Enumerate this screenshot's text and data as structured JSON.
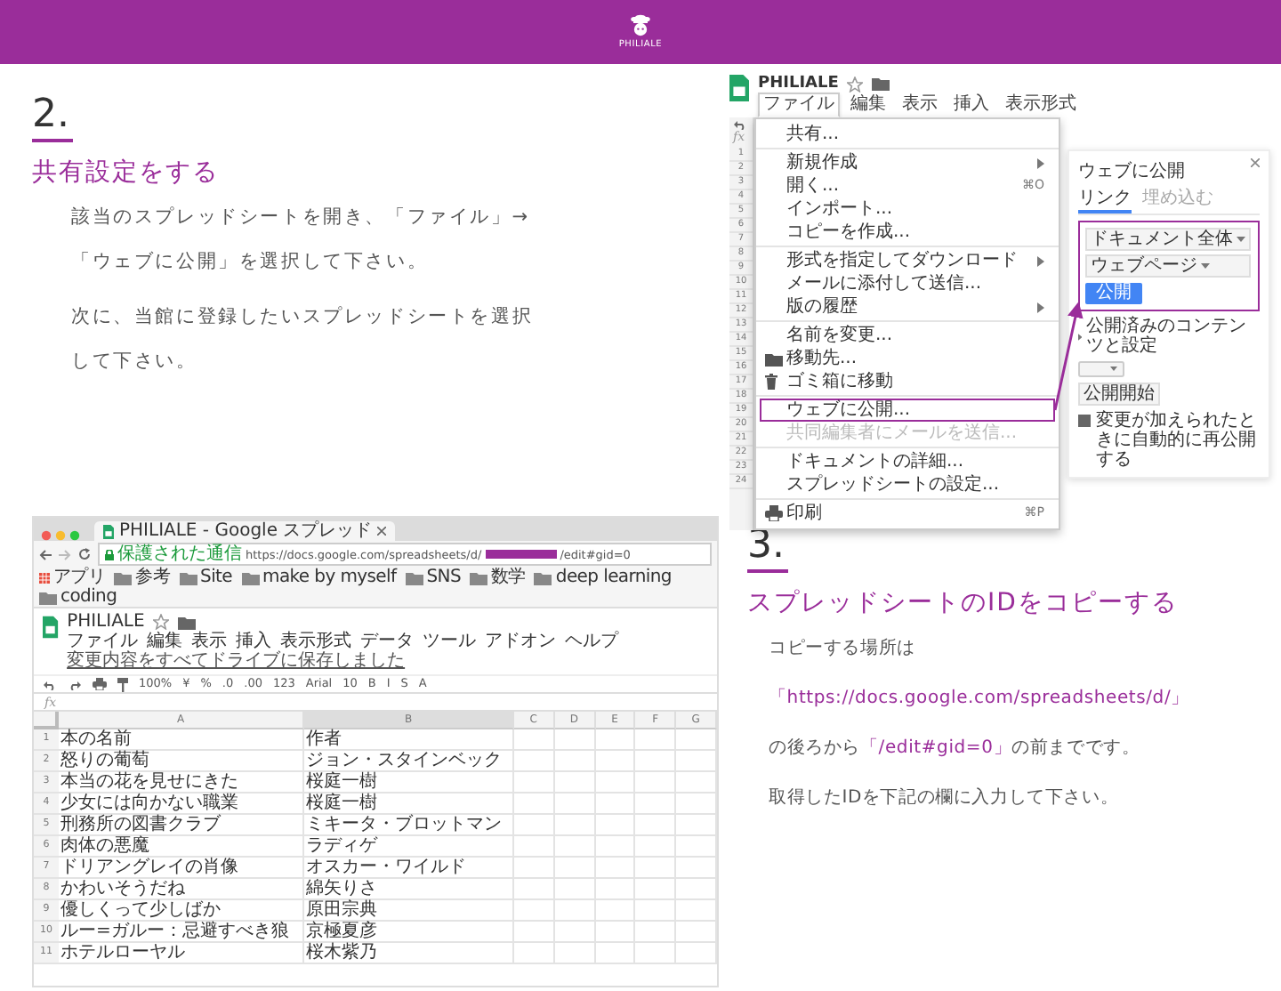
{
  "header": {
    "logo_text": "PHILIALE"
  },
  "steps": [
    {
      "number": "2.",
      "title": "共有設定をする",
      "paragraphs": [
        [
          {
            "text": "該当のスプレッドシートを開き、「ファイル」→「ウェブに公開」を選択して下さい。",
            "highlight": false
          }
        ],
        [
          {
            "text": "次に、当館に登録したいスプレッドシートを選択して下さい。",
            "highlight": false
          }
        ]
      ]
    },
    {
      "number": "3.",
      "title": "スプレッドシートのIDをコピーする",
      "paragraphs": [
        [
          {
            "text": "コピーする場所は",
            "highlight": false
          }
        ],
        [
          {
            "text": "「https://docs.google.com/spreadsheets/d/」",
            "highlight": true
          }
        ],
        [
          {
            "text": "の後ろから",
            "highlight": false
          },
          {
            "text": "「/edit#gid=0」",
            "highlight": true
          },
          {
            "text": "の前までです。",
            "highlight": false
          }
        ],
        [
          {
            "text": "取得したIDを下記の欄に入力して下さい。",
            "highlight": false
          }
        ]
      ]
    }
  ],
  "menu_screenshot": {
    "doc_title": "PHILIALE",
    "menu_bar": [
      {
        "label": "ファイル",
        "selected": true
      },
      {
        "label": "編集",
        "selected": false
      },
      {
        "label": "表示",
        "selected": false
      },
      {
        "label": "挿入",
        "selected": false
      },
      {
        "label": "表示形式",
        "selected": false
      }
    ],
    "fx_label": "fx",
    "row_numbers": [
      "1",
      "2",
      "3",
      "4",
      "5",
      "6",
      "7",
      "8",
      "9",
      "10",
      "11",
      "12",
      "13",
      "14",
      "15",
      "16",
      "17",
      "18",
      "19",
      "20",
      "21",
      "22",
      "23",
      "24"
    ],
    "file_menu": [
      [
        {
          "label": "共有...",
          "kind": "item",
          "submenu": false,
          "highlighted": false,
          "disabled": false
        }
      ],
      [
        {
          "label": "新規作成",
          "kind": "item",
          "submenu": true,
          "highlighted": false,
          "disabled": false
        },
        {
          "label": "開く...",
          "kind": "item",
          "shortcut": "⌘O",
          "submenu": false,
          "highlighted": false,
          "disabled": false
        },
        {
          "label": "インポート...",
          "kind": "item",
          "submenu": false,
          "highlighted": false,
          "disabled": false
        },
        {
          "label": "コピーを作成...",
          "kind": "item",
          "submenu": false,
          "highlighted": false,
          "disabled": false
        }
      ],
      [
        {
          "label": "形式を指定してダウンロード",
          "kind": "item",
          "submenu": true,
          "highlighted": false,
          "disabled": false
        },
        {
          "label": "メールに添付して送信...",
          "kind": "item",
          "submenu": false,
          "highlighted": false,
          "disabled": false
        },
        {
          "label": "版の履歴",
          "kind": "item",
          "submenu": true,
          "highlighted": false,
          "disabled": false
        }
      ],
      [
        {
          "label": "名前を変更...",
          "kind": "item",
          "submenu": false,
          "highlighted": false,
          "disabled": false
        },
        {
          "label": "移動先...",
          "kind": "move",
          "submenu": false,
          "highlighted": false,
          "disabled": false
        },
        {
          "label": "ゴミ箱に移動",
          "kind": "delete",
          "submenu": false,
          "highlighted": false,
          "disabled": false
        }
      ],
      [
        {
          "label": "ウェブに公開...",
          "kind": "item",
          "submenu": false,
          "highlighted": true,
          "disabled": false
        },
        {
          "label": "共同編集者にメールを送信...",
          "kind": "item",
          "submenu": false,
          "highlighted": false,
          "disabled": true
        }
      ],
      [
        {
          "label": "ドキュメントの詳細...",
          "kind": "item",
          "submenu": false,
          "highlighted": false,
          "disabled": false
        },
        {
          "label": "スプレッドシートの設定...",
          "kind": "item",
          "submenu": false,
          "highlighted": false,
          "disabled": false
        }
      ],
      [
        {
          "label": "印刷",
          "kind": "print",
          "shortcut": "⌘P",
          "submenu": false,
          "highlighted": false,
          "disabled": false
        }
      ]
    ],
    "dialog": {
      "title": "ウェブに公開",
      "tabs": [
        {
          "label": "リンク",
          "selected": true
        },
        {
          "label": "埋め込む",
          "selected": false
        }
      ],
      "selectors": [
        "ドキュメント全体",
        "ウェブページ"
      ],
      "publish_button": "公開",
      "section_title": "公開済みのコンテンツと設定",
      "start_button": "公開開始",
      "auto_republish": {
        "label": "変更が加えられたときに自動的に再公開する",
        "checked": true
      }
    }
  },
  "sheet_screenshot": {
    "tab_title": "PHILIALE - Google スプレッド",
    "secure_label": "保護された通信",
    "url_start": "https://docs.google.com/spreadsheets/d/",
    "url_end": "/edit#gid=0",
    "bookmarks": [
      "アプリ",
      "参考",
      "Site",
      "make by myself",
      "SNS",
      "数学",
      "deep learning",
      "coding"
    ],
    "doc_title": "PHILIALE",
    "menu_bar": [
      "ファイル",
      "編集",
      "表示",
      "挿入",
      "表示形式",
      "データ",
      "ツール",
      "アドオン",
      "ヘルプ"
    ],
    "save_status": "変更内容をすべてドライブに保存しました",
    "toolbar": [
      "100%",
      "¥",
      "%",
      ".0",
      ".00",
      "123",
      "Arial",
      "10",
      "B",
      "I",
      "S",
      "A"
    ],
    "fx_label": "fx",
    "columns": [
      {
        "label": "A",
        "selected": false
      },
      {
        "label": "B",
        "selected": true
      },
      {
        "label": "C",
        "selected": false
      },
      {
        "label": "D",
        "selected": false
      },
      {
        "label": "E",
        "selected": false
      },
      {
        "label": "F",
        "selected": false
      },
      {
        "label": "G",
        "selected": false
      }
    ],
    "rows": [
      {
        "number": "1",
        "cells": [
          "本の名前",
          "作者"
        ]
      },
      {
        "number": "2",
        "cells": [
          "怒りの葡萄",
          "ジョン・スタインベック"
        ]
      },
      {
        "number": "3",
        "cells": [
          "本当の花を見せにきた",
          "桜庭一樹"
        ]
      },
      {
        "number": "4",
        "cells": [
          "少女には向かない職業",
          "桜庭一樹"
        ]
      },
      {
        "number": "5",
        "cells": [
          "刑務所の図書クラブ",
          "ミキータ・ブロットマン"
        ]
      },
      {
        "number": "6",
        "cells": [
          "肉体の悪魔",
          "ラディゲ"
        ]
      },
      {
        "number": "7",
        "cells": [
          "ドリアングレイの肖像",
          "オスカー・ワイルド"
        ]
      },
      {
        "number": "8",
        "cells": [
          "かわいそうだね",
          "綿矢りさ"
        ]
      },
      {
        "number": "9",
        "cells": [
          "優しくって少しばか",
          "原田宗典"
        ]
      },
      {
        "number": "10",
        "cells": [
          "ルー=ガルー：忌避すべき狼",
          "京極夏彦"
        ]
      },
      {
        "number": "11",
        "cells": [
          "ホテルローヤル",
          "桜木紫乃"
        ]
      }
    ]
  }
}
